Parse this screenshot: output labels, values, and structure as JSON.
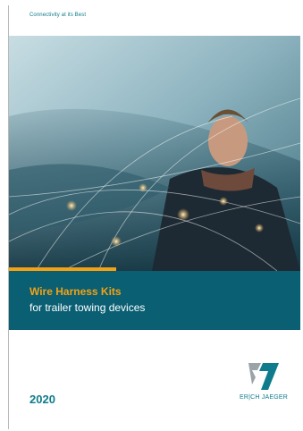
{
  "header": {
    "tagline": "Connectivity at its Best"
  },
  "cover": {
    "title": "Wire Harness Kits",
    "subtitle": "for trailer towing devices",
    "year": "2020"
  },
  "brand": {
    "name": "ER|CH JAEGER",
    "logo_icon": "erich-jaeger-logo-mark"
  },
  "colors": {
    "teal": "#0e7c8c",
    "band": "#0a5f73",
    "accent": "#f4a114"
  }
}
